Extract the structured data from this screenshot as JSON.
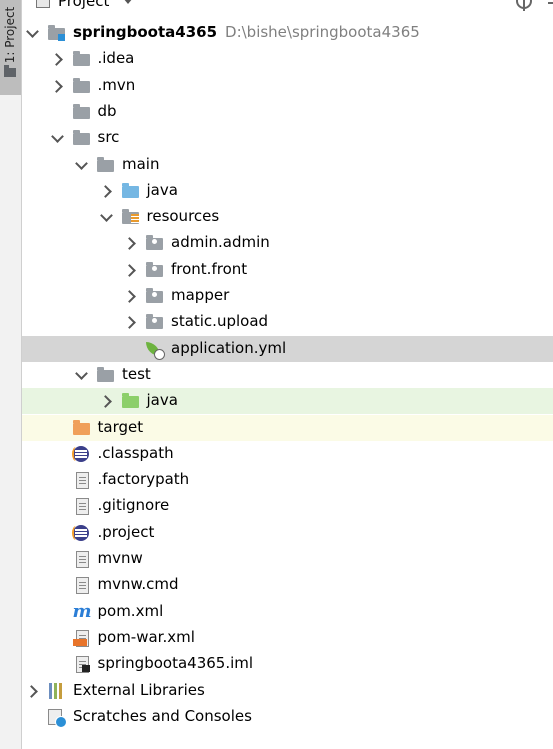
{
  "sidebar": {
    "tab_label": "1: Project"
  },
  "header": {
    "title": "Project"
  },
  "tree": [
    {
      "label": "springboota4365",
      "path": "D:\\bishe\\springboota4365",
      "bold": true,
      "depth": 0,
      "chevron": "down",
      "icon": "project-folder-icon",
      "row": ""
    },
    {
      "label": ".idea",
      "depth": 1,
      "chevron": "right",
      "icon": "folder-icon",
      "row": ""
    },
    {
      "label": ".mvn",
      "depth": 1,
      "chevron": "right",
      "icon": "folder-icon",
      "row": ""
    },
    {
      "label": "db",
      "depth": 1,
      "chevron": "",
      "icon": "folder-icon",
      "row": ""
    },
    {
      "label": "src",
      "depth": 1,
      "chevron": "down",
      "icon": "folder-icon",
      "row": ""
    },
    {
      "label": "main",
      "depth": 2,
      "chevron": "down",
      "icon": "folder-icon",
      "row": ""
    },
    {
      "label": "java",
      "depth": 3,
      "chevron": "right",
      "icon": "source-folder-icon",
      "row": ""
    },
    {
      "label": "resources",
      "depth": 3,
      "chevron": "down",
      "icon": "resources-folder-icon",
      "row": ""
    },
    {
      "label": "admin.admin",
      "depth": 4,
      "chevron": "right",
      "icon": "package-icon",
      "row": ""
    },
    {
      "label": "front.front",
      "depth": 4,
      "chevron": "right",
      "icon": "package-icon",
      "row": ""
    },
    {
      "label": "mapper",
      "depth": 4,
      "chevron": "right",
      "icon": "package-icon",
      "row": ""
    },
    {
      "label": "static.upload",
      "depth": 4,
      "chevron": "right",
      "icon": "package-icon",
      "row": ""
    },
    {
      "label": "application.yml",
      "depth": 4,
      "chevron": "",
      "icon": "spring-config-icon",
      "row": "selected"
    },
    {
      "label": "test",
      "depth": 2,
      "chevron": "down",
      "icon": "folder-icon",
      "row": ""
    },
    {
      "label": "java",
      "depth": 3,
      "chevron": "right",
      "icon": "test-folder-icon",
      "row": "test"
    },
    {
      "label": "target",
      "depth": 1,
      "chevron": "",
      "icon": "excluded-folder-icon",
      "row": "excluded"
    },
    {
      "label": ".classpath",
      "depth": 1,
      "chevron": "",
      "icon": "eclipse-icon",
      "row": ""
    },
    {
      "label": ".factorypath",
      "depth": 1,
      "chevron": "",
      "icon": "text-file-icon",
      "row": ""
    },
    {
      "label": ".gitignore",
      "depth": 1,
      "chevron": "",
      "icon": "text-file-icon",
      "row": ""
    },
    {
      "label": ".project",
      "depth": 1,
      "chevron": "",
      "icon": "eclipse-icon",
      "row": ""
    },
    {
      "label": "mvnw",
      "depth": 1,
      "chevron": "",
      "icon": "text-file-icon",
      "row": ""
    },
    {
      "label": "mvnw.cmd",
      "depth": 1,
      "chevron": "",
      "icon": "text-file-icon",
      "row": ""
    },
    {
      "label": "pom.xml",
      "depth": 1,
      "chevron": "",
      "icon": "maven-icon",
      "row": ""
    },
    {
      "label": "pom-war.xml",
      "depth": 1,
      "chevron": "",
      "icon": "xml-file-icon",
      "row": ""
    },
    {
      "label": "springboota4365.iml",
      "depth": 1,
      "chevron": "",
      "icon": "iml-file-icon",
      "row": ""
    },
    {
      "label": "External Libraries",
      "depth": 0,
      "chevron": "right",
      "icon": "libraries-icon",
      "row": ""
    },
    {
      "label": "Scratches and Consoles",
      "depth": 0,
      "chevron": "",
      "icon": "scratches-icon",
      "row": ""
    }
  ],
  "colors": {
    "selected_row": "#d5d5d5",
    "test_row": "#e8f5e1",
    "excluded_row": "#fbfbe6",
    "source_folder": "#75b7e3",
    "test_folder": "#8ccf6a",
    "excluded_folder": "#f0a05a"
  }
}
